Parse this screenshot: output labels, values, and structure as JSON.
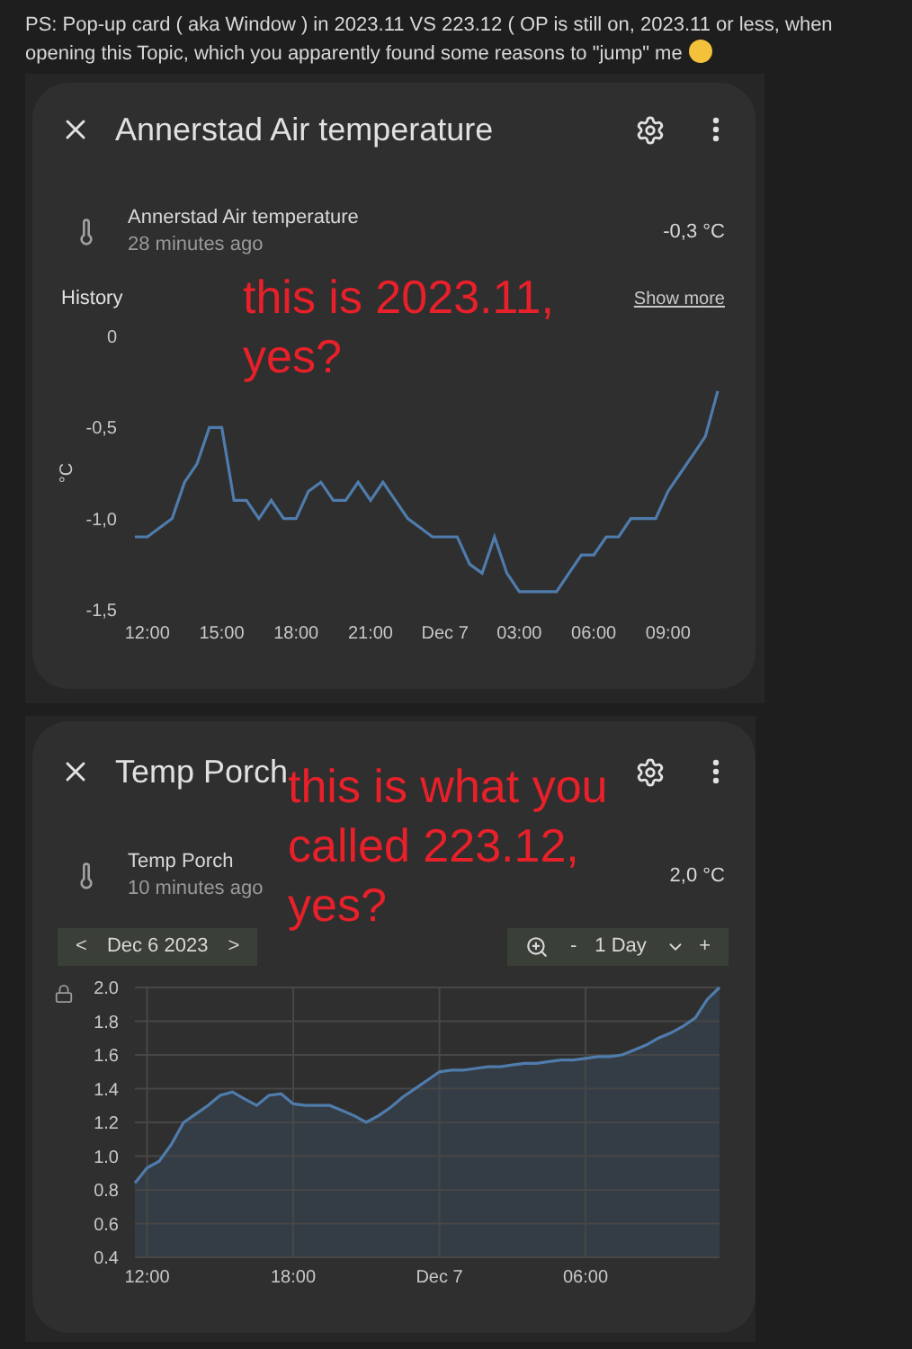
{
  "post": {
    "text": "PS: Pop-up card ( aka Window ) in 2023.11 VS 223.12 ( OP is still on, 2023.11 or less, when opening this Topic, which you apparently found some reasons to \"jump\" me"
  },
  "screenshots": [
    {
      "dialog": {
        "title": "Annerstad Air temperature",
        "entity": {
          "name": "Annerstad Air temperature",
          "time": "28 minutes ago",
          "value": "-0,3 °C"
        },
        "history_label": "History",
        "show_more": "Show more",
        "chart_data": {
          "type": "line",
          "ylabel": "°C",
          "ylim": [
            -1.5,
            0
          ],
          "yticks": [
            {
              "value": 0,
              "label": "0"
            },
            {
              "value": -0.5,
              "label": "-0,5"
            },
            {
              "value": -1,
              "label": "-1,0"
            },
            {
              "value": -1.5,
              "label": "-1,5"
            }
          ],
          "categories": [
            null,
            "12:00",
            null,
            null,
            null,
            null,
            null,
            "15:00",
            null,
            null,
            null,
            null,
            null,
            "18:00",
            null,
            null,
            null,
            null,
            null,
            "21:00",
            null,
            null,
            null,
            null,
            null,
            "Dec 7",
            null,
            null,
            null,
            null,
            null,
            "03:00",
            null,
            null,
            null,
            null,
            null,
            "06:00",
            null,
            null,
            null,
            null,
            null,
            "09:00",
            null,
            null,
            null,
            null
          ],
          "series": [
            {
              "color": "#4f7cac",
              "values": [
                -1.1,
                -1.1,
                -1.05,
                -1.0,
                -0.8,
                -0.7,
                -0.5,
                -0.5,
                -0.9,
                -0.9,
                -1.0,
                -0.9,
                -1.0,
                -1.0,
                -0.85,
                -0.8,
                -0.9,
                -0.9,
                -0.8,
                -0.9,
                -0.8,
                -0.9,
                -1.0,
                -1.05,
                -1.1,
                -1.1,
                -1.1,
                -1.25,
                -1.3,
                -1.1,
                -1.3,
                -1.4,
                -1.4,
                -1.4,
                -1.4,
                -1.3,
                -1.2,
                -1.2,
                -1.1,
                -1.1,
                -1.0,
                -1.0,
                -1.0,
                -0.85,
                -0.75,
                -0.65,
                -0.55,
                -0.3
              ]
            }
          ]
        }
      },
      "annotation": "this is 2023.11,\nyes?"
    },
    {
      "dialog": {
        "title": "Temp Porch",
        "entity": {
          "name": "Temp Porch",
          "time": "10 minutes ago",
          "value": "2,0 °C"
        },
        "date_picker": {
          "prev": "<",
          "date": "Dec 6 2023",
          "next": ">"
        },
        "zoom": {
          "minus": "-",
          "range": "1 Day",
          "plus": "+"
        },
        "chart_data": {
          "type": "area",
          "grid": true,
          "ylim": [
            0.4,
            2.0
          ],
          "yticks": [
            {
              "value": 0.4,
              "label": "0.4"
            },
            {
              "value": 0.6,
              "label": "0.6"
            },
            {
              "value": 0.8,
              "label": "0.8"
            },
            {
              "value": 1.0,
              "label": "1.0"
            },
            {
              "value": 1.2,
              "label": "1.2"
            },
            {
              "value": 1.4,
              "label": "1.4"
            },
            {
              "value": 1.6,
              "label": "1.6"
            },
            {
              "value": 1.8,
              "label": "1.8"
            },
            {
              "value": 2.0,
              "label": "2.0"
            }
          ],
          "categories": [
            null,
            "12:00",
            null,
            null,
            null,
            null,
            null,
            null,
            null,
            null,
            null,
            null,
            null,
            "18:00",
            null,
            null,
            null,
            null,
            null,
            null,
            null,
            null,
            null,
            null,
            null,
            "Dec 7",
            null,
            null,
            null,
            null,
            null,
            null,
            null,
            null,
            null,
            null,
            null,
            "06:00",
            null,
            null,
            null,
            null,
            null,
            null,
            null,
            null,
            null,
            null,
            null
          ],
          "series": [
            {
              "color": "#4f7cac",
              "values": [
                0.84,
                0.93,
                0.97,
                1.07,
                1.2,
                1.25,
                1.3,
                1.36,
                1.38,
                1.34,
                1.3,
                1.36,
                1.37,
                1.31,
                1.3,
                1.3,
                1.3,
                1.27,
                1.24,
                1.2,
                1.24,
                1.29,
                1.35,
                1.4,
                1.45,
                1.5,
                1.51,
                1.51,
                1.52,
                1.53,
                1.53,
                1.54,
                1.55,
                1.55,
                1.56,
                1.57,
                1.57,
                1.58,
                1.59,
                1.59,
                1.6,
                1.63,
                1.66,
                1.7,
                1.73,
                1.77,
                1.82,
                1.93,
                2.0
              ]
            }
          ]
        }
      },
      "annotation": "this is what you\ncalled 223.12,\nyes?"
    }
  ]
}
